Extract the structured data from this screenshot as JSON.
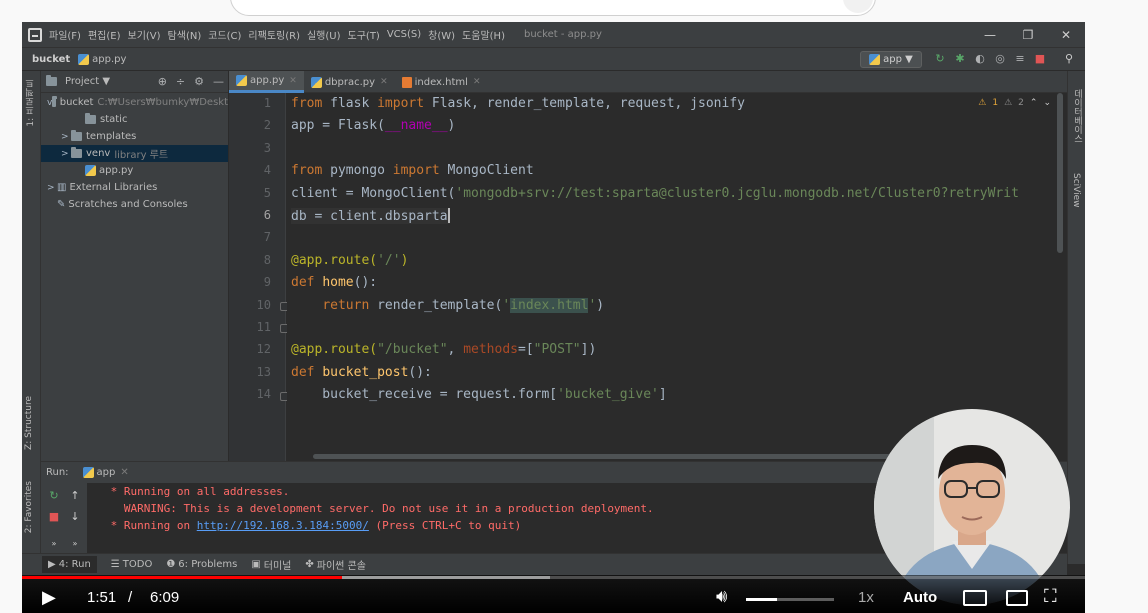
{
  "window": {
    "title": "bucket - app.py",
    "menu": [
      "파일(F)",
      "편집(E)",
      "보기(V)",
      "탐색(N)",
      "코드(C)",
      "리팩토링(R)",
      "실행(U)",
      "도구(T)",
      "VCS(S)",
      "창(W)",
      "도움말(H)"
    ],
    "controls": [
      "—",
      "❐",
      "✕"
    ]
  },
  "navbar": {
    "project": "bucket",
    "file": "app.py",
    "run_config": "app ▼"
  },
  "left_stripe": {
    "project_tab": "1: 프로젝트",
    "structure_tab": "Z: Structure",
    "favorites_tab": "2: Favorites"
  },
  "right_stripe": {
    "database_tab": "데이터베이스",
    "sciview_tab": "SciView"
  },
  "project_panel": {
    "title": "Project ▼",
    "tree": [
      {
        "label": "bucket",
        "extra": "C:₩Users₩bumky₩Deskt",
        "type": "folder",
        "depth": 0,
        "expanded": "v"
      },
      {
        "label": "static",
        "extra": "",
        "type": "folder",
        "depth": 2,
        "expanded": ""
      },
      {
        "label": "templates",
        "extra": "",
        "type": "folder",
        "depth": 1,
        "expanded": ">"
      },
      {
        "label": "venv",
        "extra": "library 루트",
        "type": "folder",
        "depth": 1,
        "expanded": ">"
      },
      {
        "label": "app.py",
        "extra": "",
        "type": "py",
        "depth": 2,
        "expanded": ""
      },
      {
        "label": "External Libraries",
        "extra": "",
        "type": "lib",
        "depth": 0,
        "expanded": ">"
      },
      {
        "label": "Scratches and Consoles",
        "extra": "",
        "type": "scratch",
        "depth": 0,
        "expanded": ""
      }
    ]
  },
  "tabs": [
    {
      "label": "app.py",
      "active": true
    },
    {
      "label": "dbprac.py",
      "active": false
    },
    {
      "label": "index.html",
      "active": false
    }
  ],
  "inspection": {
    "warnings": "1",
    "weak": "2"
  },
  "editor": {
    "line_numbers": [
      "1",
      "2",
      "3",
      "4",
      "5",
      "6",
      "7",
      "8",
      "9",
      "10",
      "11",
      "12",
      "13",
      "14"
    ],
    "lines": [
      [
        {
          "t": "from",
          "c": "kw"
        },
        {
          "t": " flask ",
          "c": ""
        },
        {
          "t": "import",
          "c": "kw"
        },
        {
          "t": " Flask, render_template, request, jsonify",
          "c": ""
        }
      ],
      [
        {
          "t": "app = Flask(",
          "c": ""
        },
        {
          "t": "__name__",
          "c": "dunder"
        },
        {
          "t": ")",
          "c": ""
        }
      ],
      [],
      [
        {
          "t": "from",
          "c": "kw"
        },
        {
          "t": " pymongo ",
          "c": ""
        },
        {
          "t": "import",
          "c": "kw"
        },
        {
          "t": " MongoClient",
          "c": ""
        }
      ],
      [
        {
          "t": "client = MongoClient(",
          "c": ""
        },
        {
          "t": "'mongodb+srv://test:sparta@cluster0.jcglu.mongodb.net/Cluster0?retryWrit",
          "c": "str"
        }
      ],
      [
        {
          "t": "db = client.dbsparta",
          "c": ""
        }
      ],
      [],
      [
        {
          "t": "@app.route(",
          "c": "dec"
        },
        {
          "t": "'/'",
          "c": "str"
        },
        {
          "t": ")",
          "c": "dec"
        }
      ],
      [
        {
          "t": "def",
          "c": "kw"
        },
        {
          "t": " ",
          "c": ""
        },
        {
          "t": "home",
          "c": "fn"
        },
        {
          "t": "():",
          "c": ""
        }
      ],
      [
        {
          "t": "    ",
          "c": ""
        },
        {
          "t": "return",
          "c": "kw"
        },
        {
          "t": " render_template(",
          "c": ""
        },
        {
          "t": "'",
          "c": "str"
        },
        {
          "t": "index.html",
          "c": "strhl"
        },
        {
          "t": "'",
          "c": "str"
        },
        {
          "t": ")",
          "c": ""
        }
      ],
      [],
      [
        {
          "t": "@app.route(",
          "c": "dec"
        },
        {
          "t": "\"/bucket\"",
          "c": "str"
        },
        {
          "t": ", ",
          "c": ""
        },
        {
          "t": "methods",
          "c": "prm"
        },
        {
          "t": "=[",
          "c": ""
        },
        {
          "t": "\"POST\"",
          "c": "str"
        },
        {
          "t": "])",
          "c": ""
        }
      ],
      [
        {
          "t": "def",
          "c": "kw"
        },
        {
          "t": " ",
          "c": ""
        },
        {
          "t": "bucket_post",
          "c": "fn"
        },
        {
          "t": "():",
          "c": ""
        }
      ],
      [
        {
          "t": "    bucket_receive = request.form[",
          "c": ""
        },
        {
          "t": "'bucket_give'",
          "c": "str"
        },
        {
          "t": "]",
          "c": ""
        }
      ]
    ],
    "current_line": "6"
  },
  "run": {
    "label": "Run:",
    "config": "app",
    "output": [
      {
        "text": " * Running on all addresses.",
        "link": "",
        "after": ""
      },
      {
        "text": "   WARNING: This is a development server. Do not use it in a production deployment.",
        "link": "",
        "after": ""
      },
      {
        "text": " * Running on ",
        "link": "http://192.168.3.184:5000/",
        "after": " (Press CTRL+C to quit)"
      }
    ]
  },
  "bottom_tabs": [
    "4: Run",
    "TODO",
    "6: Problems",
    "터미널",
    "파이썬 콘솔"
  ],
  "player": {
    "current_time": "1:51",
    "separator": "/",
    "duration": "6:09",
    "played_fraction": 0.301,
    "buffered_fraction": 0.497,
    "volume_fraction": 0.35,
    "speed": "1x",
    "quality": "Auto"
  }
}
